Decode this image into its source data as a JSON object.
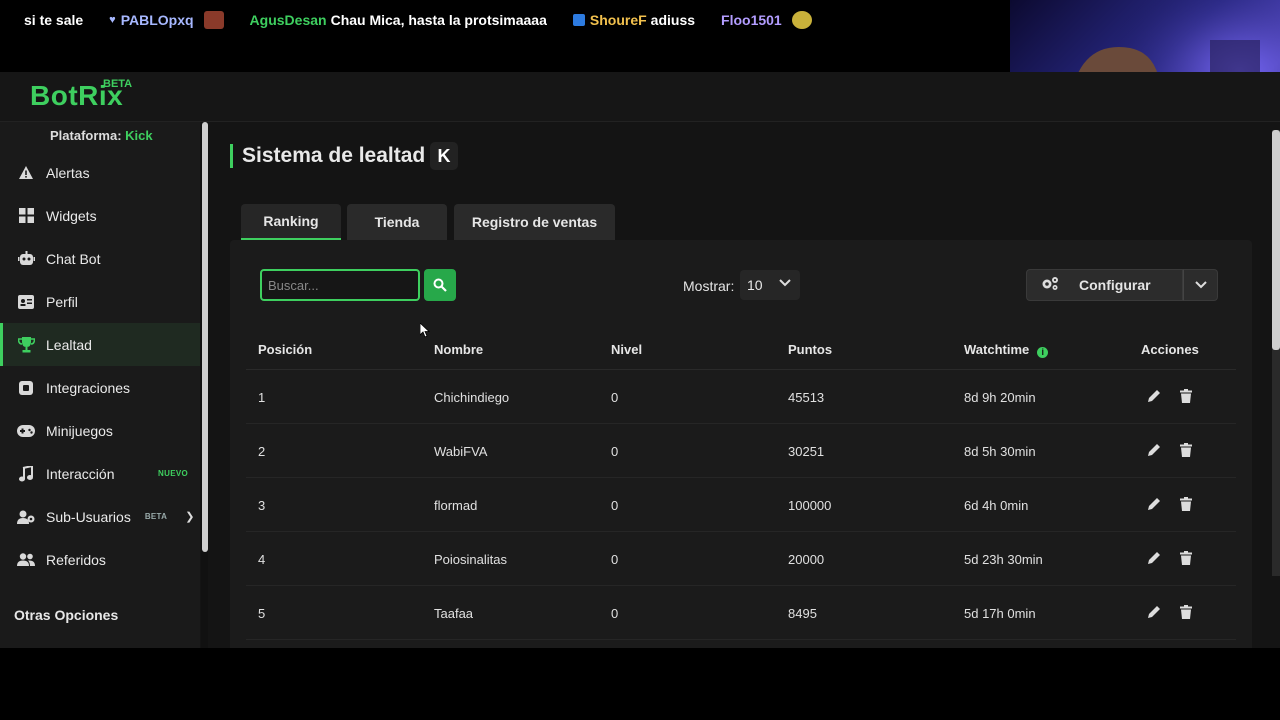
{
  "ticker": {
    "items": [
      {
        "user": "",
        "user_color": "#ffffff",
        "message": "si te sale"
      },
      {
        "user": "PABLOpxq",
        "user_color": "#a7b8ff",
        "message": ""
      },
      {
        "user": "AgusDesan",
        "user_color": "#3ecf5f",
        "message": "Chau Mica, hasta la protsimaaaa"
      },
      {
        "user": "ShoureF",
        "user_color": "#f2c14e",
        "message": "adiuss"
      },
      {
        "user": "Floo1501",
        "user_color": "#b39dff",
        "message": ""
      }
    ]
  },
  "app": {
    "logo": "BotRix",
    "logo_badge": "BETA",
    "accent_color": "#3ecf5f"
  },
  "sidebar": {
    "platform_label": "Plataforma:",
    "platform_value": "Kick",
    "items": [
      {
        "label": "Alertas",
        "icon": "warning-icon",
        "badge": ""
      },
      {
        "label": "Widgets",
        "icon": "widgets-grid-icon",
        "badge": ""
      },
      {
        "label": "Chat Bot",
        "icon": "robot-icon",
        "badge": ""
      },
      {
        "label": "Perfil",
        "icon": "id-card-icon",
        "badge": ""
      },
      {
        "label": "Lealtad",
        "icon": "trophy-icon",
        "badge": "",
        "active": true
      },
      {
        "label": "Integraciones",
        "icon": "plug-icon",
        "badge": ""
      },
      {
        "label": "Minijuegos",
        "icon": "gamepad-icon",
        "badge": ""
      },
      {
        "label": "Interacción",
        "icon": "music-note-icon",
        "badge": "NUEVO"
      },
      {
        "label": "Sub-Usuarios",
        "icon": "users-gear-icon",
        "badge": "BETA"
      },
      {
        "label": "Referidos",
        "icon": "users-icon",
        "badge": ""
      }
    ],
    "section_title": "Otras Opciones"
  },
  "main": {
    "title": "Sistema de lealtad",
    "platform_logo": "K",
    "tabs": [
      {
        "label": "Ranking",
        "active": true
      },
      {
        "label": "Tienda",
        "active": false
      },
      {
        "label": "Registro de ventas",
        "active": false
      }
    ],
    "search": {
      "placeholder": "Buscar...",
      "value": ""
    },
    "show_label": "Mostrar:",
    "show_value": "10",
    "configure_label": "Configurar"
  },
  "table": {
    "headers": [
      "Posición",
      "Nombre",
      "Nivel",
      "Puntos",
      "Watchtime",
      "Acciones"
    ],
    "rows": [
      {
        "pos": "1",
        "name": "Chichindiego",
        "level": "0",
        "points": "45513",
        "watchtime": "8d 9h 20min"
      },
      {
        "pos": "2",
        "name": "WabiFVA",
        "level": "0",
        "points": "30251",
        "watchtime": "8d 5h 30min"
      },
      {
        "pos": "3",
        "name": "flormad",
        "level": "0",
        "points": "100000",
        "watchtime": "6d 4h 0min"
      },
      {
        "pos": "4",
        "name": "Poiosinalitas",
        "level": "0",
        "points": "20000",
        "watchtime": "5d 23h 30min"
      },
      {
        "pos": "5",
        "name": "Taafaa",
        "level": "0",
        "points": "8495",
        "watchtime": "5d 17h 0min"
      }
    ]
  }
}
